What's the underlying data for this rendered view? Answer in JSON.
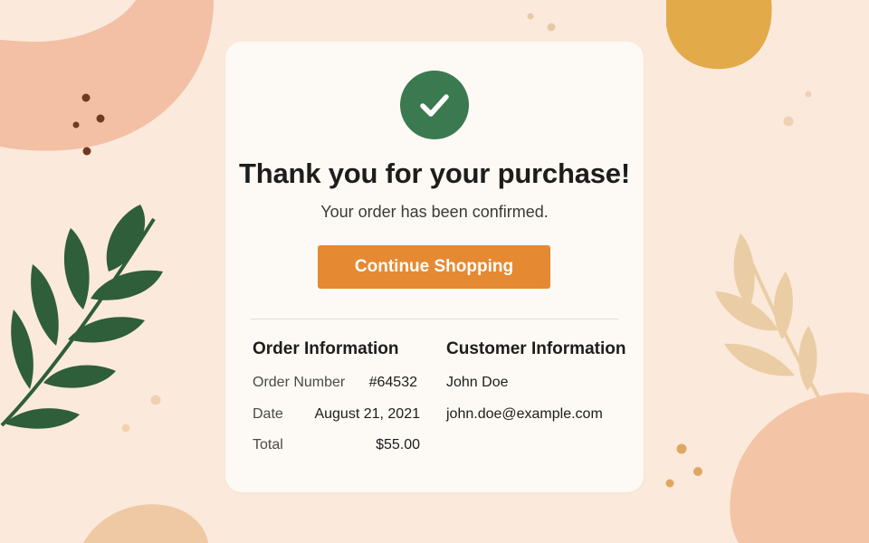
{
  "page": {
    "title": "Thank you for your purchase!",
    "subtitle": "Your order has been confirmed.",
    "continue_label": "Continue Shopping"
  },
  "order": {
    "heading": "Order Information",
    "number_label": "Order Number",
    "number_value": "#64532",
    "date_label": "Date",
    "date_value": "August 21, 2021",
    "total_label": "Total",
    "total_value": "$55.00"
  },
  "customer": {
    "heading": "Customer Information",
    "name": "John Doe",
    "email": "john.doe@example.com"
  },
  "colors": {
    "background": "#fbeadb",
    "card": "#fdf9f4",
    "success": "#3b7a51",
    "accent": "#e58933",
    "leaf_dark": "#2f5e3b",
    "leaf_light": "#ebcda5"
  },
  "icons": [
    "check-icon",
    "leaf-branch-icon"
  ]
}
